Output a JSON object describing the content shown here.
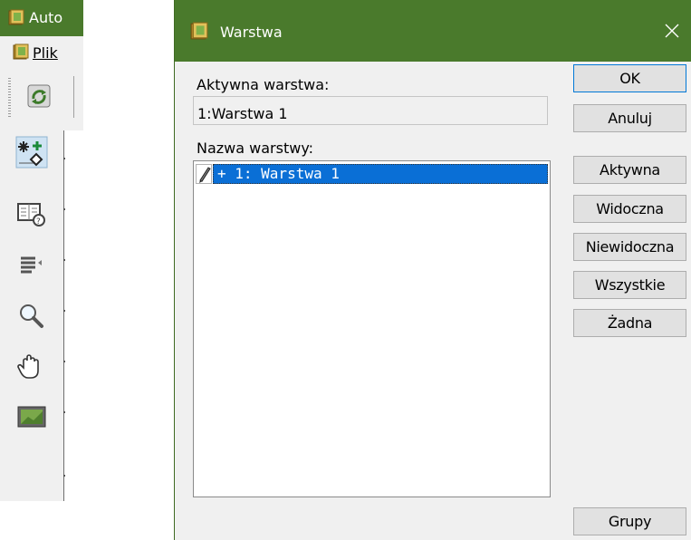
{
  "app": {
    "title": "Auto",
    "menu_label": "Plik"
  },
  "dialog": {
    "title": "Warstwa",
    "active_layer_label": "Aktywna warstwa:",
    "active_layer_value": "1:Warstwa 1",
    "layer_name_label": "Nazwa warstwy:",
    "layers": [
      {
        "text": "+ 1: Warstwa 1",
        "selected": true
      }
    ],
    "buttons": {
      "ok": "OK",
      "cancel": "Anuluj",
      "active": "Aktywna",
      "visible": "Widoczna",
      "invisible": "Niewidoczna",
      "all": "Wszystkie",
      "none": "Żadna",
      "groups": "Grupy"
    }
  },
  "colors": {
    "titlebar": "#4a7a2c",
    "selection": "#0a6fd6",
    "dialog_bg": "#f0f0f0"
  },
  "icons": {
    "app_logo": "green-book-logo-icon",
    "toolbar": "recycle-arrows-icon",
    "sidebar": [
      "snap-point-icon",
      "book-help-icon",
      "list-lines-icon",
      "magnifier-icon",
      "hand-pan-icon",
      "landscape-view-icon"
    ],
    "close": "close-icon",
    "layer_edit": "pencil-icon"
  }
}
